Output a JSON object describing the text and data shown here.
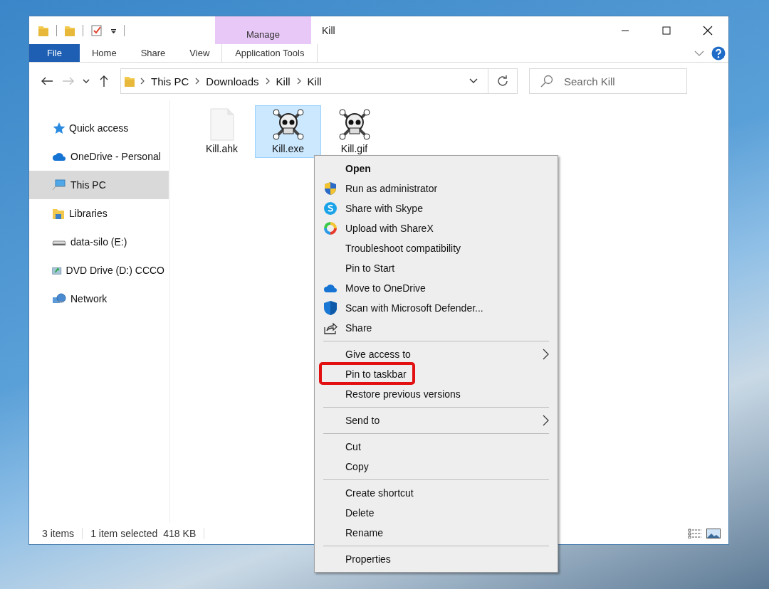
{
  "window": {
    "title": "Kill",
    "quick_access": [
      {
        "kind": "folder"
      },
      {
        "kind": "folder"
      },
      {
        "kind": "properties"
      },
      {
        "kind": "caret"
      }
    ],
    "controls": [
      {
        "kind": "minimize"
      },
      {
        "kind": "maximize"
      },
      {
        "kind": "close"
      }
    ]
  },
  "ribbon": {
    "context_group": "Manage",
    "tabs": [
      {
        "label": "File",
        "kind": "file",
        "selected": false
      },
      {
        "label": "Home",
        "kind": "tab",
        "selected": false
      },
      {
        "label": "Share",
        "kind": "tab",
        "selected": false
      },
      {
        "label": "View",
        "kind": "tab",
        "selected": false
      },
      {
        "label": "Application Tools",
        "kind": "context",
        "selected": false
      }
    ]
  },
  "address_bar": {
    "nav": [
      {
        "kind": "back",
        "disabled": false
      },
      {
        "kind": "forward",
        "disabled": true
      },
      {
        "kind": "recent",
        "disabled": false
      },
      {
        "kind": "up",
        "disabled": false
      }
    ],
    "path": [
      "This PC",
      "Downloads",
      "Kill",
      "Kill"
    ]
  },
  "search": {
    "placeholder": "Search Kill"
  },
  "sidebar": {
    "items": [
      {
        "label": "Quick access",
        "kind": "star",
        "selected": false
      },
      {
        "label": "OneDrive - Personal",
        "kind": "cloud",
        "selected": false
      },
      {
        "label": "This PC",
        "kind": "pc",
        "selected": true
      },
      {
        "label": "Libraries",
        "kind": "library",
        "selected": false
      },
      {
        "label": "data-silo (E:)",
        "kind": "drive",
        "selected": false
      },
      {
        "label": "DVD Drive (D:) CCCO",
        "kind": "dvd",
        "selected": false
      },
      {
        "label": "Network",
        "kind": "network",
        "selected": false
      }
    ]
  },
  "files": [
    {
      "name": "Kill.ahk",
      "kind": "document",
      "selected": false
    },
    {
      "name": "Kill.exe",
      "kind": "skull",
      "selected": true
    },
    {
      "name": "Kill.gif",
      "kind": "skull",
      "selected": false
    }
  ],
  "status_bar": {
    "count": "3 items",
    "selection": "1 item selected",
    "size": "418 KB"
  },
  "context_menu": {
    "items": [
      {
        "kind": "plain",
        "label": "Open",
        "default": true,
        "submenu": false,
        "highlighted": false
      },
      {
        "kind": "shield",
        "label": "Run as administrator",
        "default": false,
        "submenu": false,
        "highlighted": false
      },
      {
        "kind": "skype",
        "label": "Share with Skype",
        "default": false,
        "submenu": false,
        "highlighted": false
      },
      {
        "kind": "sharex",
        "label": "Upload with ShareX",
        "default": false,
        "submenu": false,
        "highlighted": false
      },
      {
        "kind": "plain",
        "label": "Troubleshoot compatibility",
        "default": false,
        "submenu": false,
        "highlighted": false
      },
      {
        "kind": "plain",
        "label": "Pin to Start",
        "default": false,
        "submenu": false,
        "highlighted": false
      },
      {
        "kind": "cloud",
        "label": "Move to OneDrive",
        "default": false,
        "submenu": false,
        "highlighted": false
      },
      {
        "kind": "defender",
        "label": "Scan with Microsoft Defender...",
        "default": false,
        "submenu": false,
        "highlighted": false
      },
      {
        "kind": "share",
        "label": "Share",
        "default": false,
        "submenu": false,
        "highlighted": false
      },
      {
        "kind": "separator"
      },
      {
        "kind": "plain",
        "label": "Give access to",
        "default": false,
        "submenu": true,
        "highlighted": false
      },
      {
        "kind": "plain",
        "label": "Pin to taskbar",
        "default": false,
        "submenu": false,
        "highlighted": true
      },
      {
        "kind": "plain",
        "label": "Restore previous versions",
        "default": false,
        "submenu": false,
        "highlighted": false
      },
      {
        "kind": "separator"
      },
      {
        "kind": "plain",
        "label": "Send to",
        "default": false,
        "submenu": true,
        "highlighted": false
      },
      {
        "kind": "separator"
      },
      {
        "kind": "plain",
        "label": "Cut",
        "default": false,
        "submenu": false,
        "highlighted": false
      },
      {
        "kind": "plain",
        "label": "Copy",
        "default": false,
        "submenu": false,
        "highlighted": false
      },
      {
        "kind": "separator"
      },
      {
        "kind": "plain",
        "label": "Create shortcut",
        "default": false,
        "submenu": false,
        "highlighted": false
      },
      {
        "kind": "plain",
        "label": "Delete",
        "default": false,
        "submenu": false,
        "highlighted": false
      },
      {
        "kind": "plain",
        "label": "Rename",
        "default": false,
        "submenu": false,
        "highlighted": false
      },
      {
        "kind": "separator"
      },
      {
        "kind": "plain",
        "label": "Properties",
        "default": false,
        "submenu": false,
        "highlighted": false
      }
    ]
  }
}
